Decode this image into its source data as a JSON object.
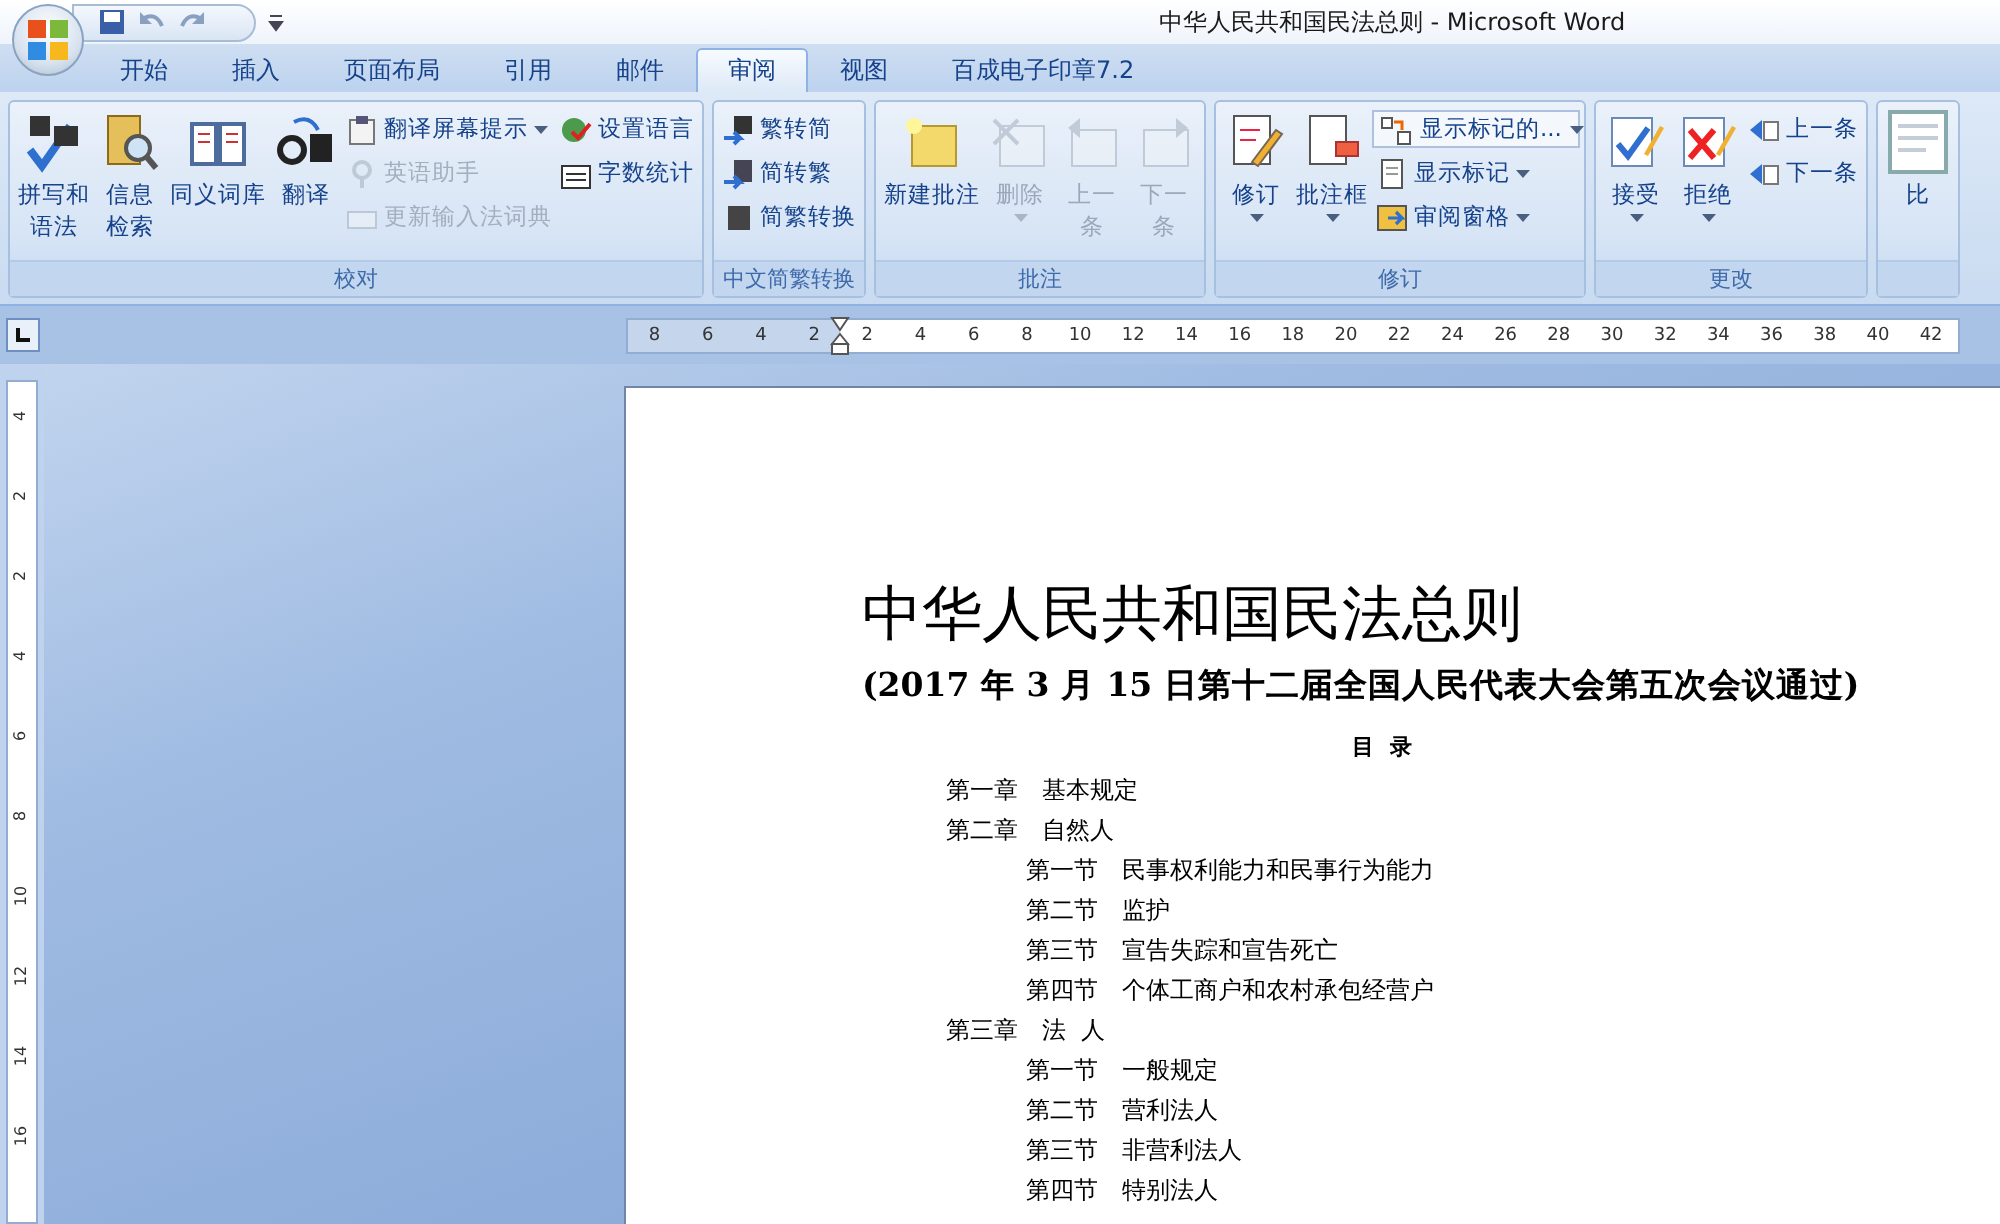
{
  "window": {
    "title": "中华人民共和国民法总则 - Microsoft Word"
  },
  "tabs": [
    {
      "label": "开始",
      "selected": false
    },
    {
      "label": "插入",
      "selected": false
    },
    {
      "label": "页面布局",
      "selected": false
    },
    {
      "label": "引用",
      "selected": false
    },
    {
      "label": "邮件",
      "selected": false
    },
    {
      "label": "审阅",
      "selected": true
    },
    {
      "label": "视图",
      "selected": false
    },
    {
      "label": "百成电子印章7.2",
      "selected": false
    }
  ],
  "ribbon_groups": [
    {
      "label": "校对",
      "items": [
        {
          "kind": "large",
          "lines": [
            "拼写和",
            "语法"
          ],
          "disabled": false,
          "dropdown": false
        },
        {
          "kind": "large",
          "lines": [
            "信息",
            "检索"
          ],
          "disabled": false,
          "dropdown": false
        },
        {
          "kind": "large",
          "lines": [
            "同义词库"
          ],
          "disabled": false,
          "dropdown": false
        },
        {
          "kind": "large",
          "lines": [
            "翻译"
          ],
          "disabled": false,
          "dropdown": false
        },
        {
          "kind": "stack",
          "items": [
            {
              "kind": "small",
              "label": "翻译屏幕提示",
              "disabled": false,
              "dropdown": true
            },
            {
              "kind": "small",
              "label": "英语助手",
              "disabled": true,
              "dropdown": false
            },
            {
              "kind": "small",
              "label": "更新输入法词典",
              "disabled": true,
              "dropdown": false
            }
          ]
        },
        {
          "kind": "stack",
          "items": [
            {
              "kind": "small",
              "label": "设置语言",
              "disabled": false,
              "dropdown": false
            },
            {
              "kind": "small",
              "label": "字数统计",
              "disabled": false,
              "dropdown": false
            }
          ]
        }
      ]
    },
    {
      "label": "中文简繁转换",
      "items": [
        {
          "kind": "stack",
          "items": [
            {
              "kind": "small",
              "label": "繁转简",
              "disabled": false,
              "dropdown": false
            },
            {
              "kind": "small",
              "label": "简转繁",
              "disabled": false,
              "dropdown": false
            },
            {
              "kind": "small",
              "label": "简繁转换",
              "disabled": false,
              "dropdown": false
            }
          ]
        }
      ]
    },
    {
      "label": "批注",
      "items": [
        {
          "kind": "large",
          "lines": [
            "新建批注"
          ],
          "disabled": false,
          "dropdown": false
        },
        {
          "kind": "large",
          "lines": [
            "删除"
          ],
          "disabled": true,
          "dropdown": true
        },
        {
          "kind": "large",
          "lines": [
            "上一",
            "条"
          ],
          "disabled": true,
          "dropdown": false
        },
        {
          "kind": "large",
          "lines": [
            "下一",
            "条"
          ],
          "disabled": true,
          "dropdown": false
        }
      ]
    },
    {
      "label": "修订",
      "items": [
        {
          "kind": "large",
          "lines": [
            "修订"
          ],
          "disabled": false,
          "dropdown": true
        },
        {
          "kind": "large",
          "lines": [
            "批注框"
          ],
          "disabled": false,
          "dropdown": true
        },
        {
          "kind": "stack",
          "items": [
            {
              "kind": "combo",
              "label": "显示标记的...",
              "disabled": false,
              "dropdown": true
            },
            {
              "kind": "small",
              "label": "显示标记",
              "disabled": false,
              "dropdown": true
            },
            {
              "kind": "small",
              "label": "审阅窗格",
              "disabled": false,
              "dropdown": true
            }
          ]
        }
      ]
    },
    {
      "label": "更改",
      "items": [
        {
          "kind": "large",
          "lines": [
            "接受"
          ],
          "disabled": false,
          "dropdown": true
        },
        {
          "kind": "large",
          "lines": [
            "拒绝"
          ],
          "disabled": false,
          "dropdown": true
        },
        {
          "kind": "stack",
          "items": [
            {
              "kind": "small",
              "label": "上一条",
              "disabled": false,
              "dropdown": false
            },
            {
              "kind": "small",
              "label": "下一条",
              "disabled": false,
              "dropdown": false
            }
          ]
        }
      ]
    },
    {
      "items": [
        {
          "kind": "large",
          "lines": [
            "比"
          ]
        }
      ]
    }
  ],
  "ruler": {
    "left_ticks": [
      "8",
      "6",
      "4",
      "2"
    ],
    "right_ticks": [
      "2",
      "4",
      "6",
      "8",
      "10",
      "12",
      "14",
      "16",
      "18",
      "20",
      "22",
      "24",
      "26",
      "28",
      "30",
      "32",
      "34",
      "36",
      "38",
      "40",
      "42"
    ]
  },
  "vertical_ruler": {
    "ticks": [
      "4",
      "2",
      "2",
      "4",
      "6",
      "8",
      "10",
      "12",
      "14",
      "16"
    ]
  },
  "document": {
    "title": "中华人民共和国民法总则",
    "subtitle": "(2017 年 3 月 15 日第十二届全国人民代表大会第五次会议通过)",
    "toc_heading": "目  录",
    "toc": [
      {
        "number": "第一章",
        "title": "基本规定"
      },
      {
        "number": "第二章",
        "title": "自然人",
        "children": [
          {
            "number": "第一节",
            "title": "民事权利能力和民事行为能力"
          },
          {
            "number": "第二节",
            "title": "监护"
          },
          {
            "number": "第三节",
            "title": "宣告失踪和宣告死亡"
          },
          {
            "number": "第四节",
            "title": "个体工商户和农村承包经营户"
          }
        ]
      },
      {
        "number": "第三章",
        "title": "法  人",
        "children": [
          {
            "number": "第一节",
            "title": "一般规定"
          },
          {
            "number": "第二节",
            "title": "营利法人"
          },
          {
            "number": "第三节",
            "title": "非营利法人"
          },
          {
            "number": "第四节",
            "title": "特别法人"
          }
        ]
      }
    ]
  }
}
